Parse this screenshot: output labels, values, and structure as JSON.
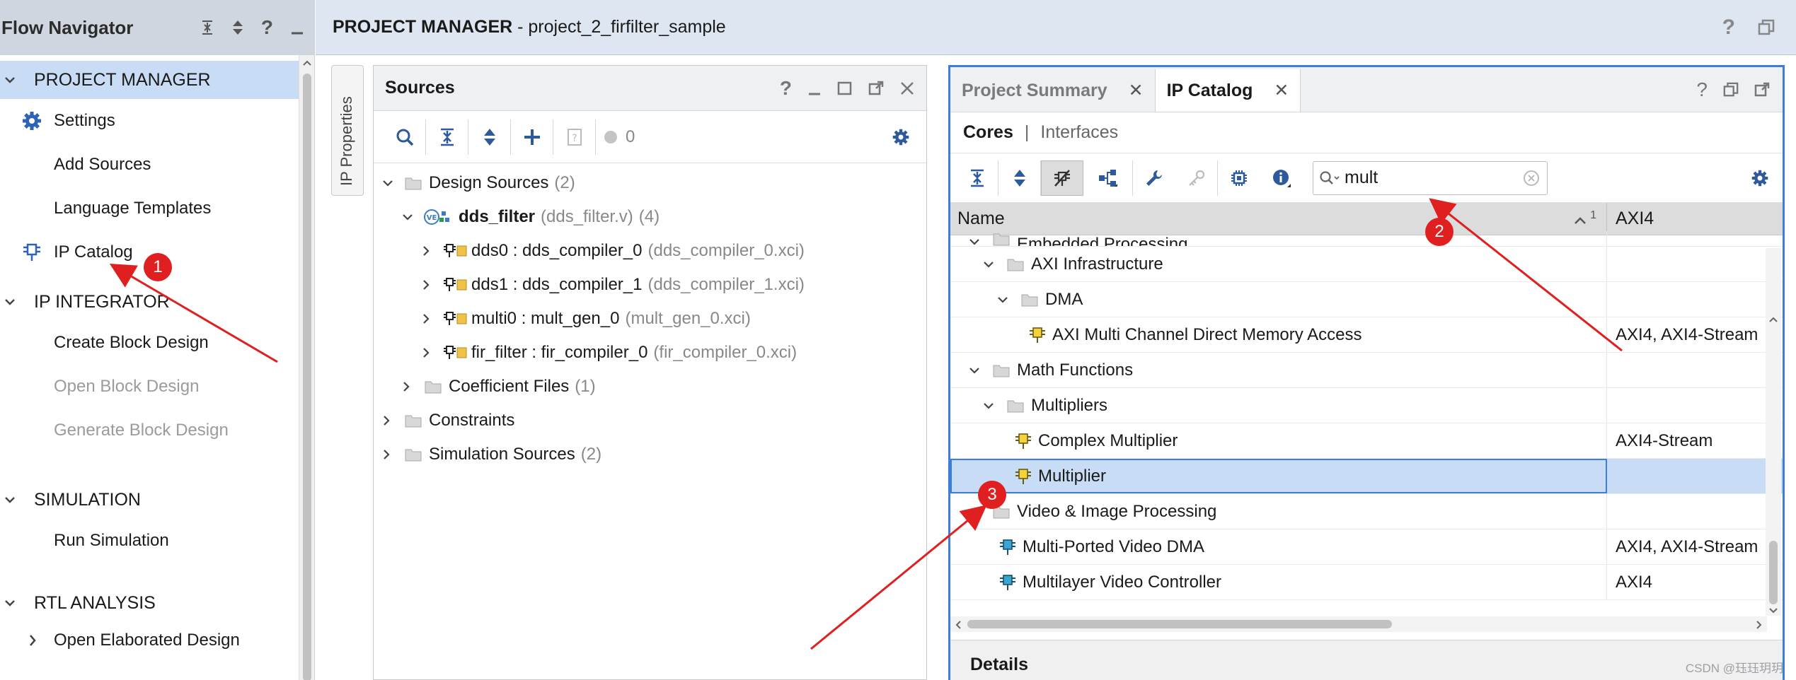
{
  "flow_navigator": {
    "title": "Flow Navigator",
    "sections": [
      {
        "label": "PROJECT MANAGER",
        "items": [
          "Settings",
          "Add Sources",
          "Language Templates",
          "IP Catalog"
        ]
      },
      {
        "label": "IP INTEGRATOR",
        "items": [
          "Create Block Design",
          "Open Block Design",
          "Generate Block Design"
        ]
      },
      {
        "label": "SIMULATION",
        "items": [
          "Run Simulation"
        ]
      },
      {
        "label": "RTL ANALYSIS",
        "items": [
          "Open Elaborated Design"
        ]
      }
    ]
  },
  "header": {
    "title_bold": "PROJECT MANAGER",
    "title_rest": " - project_2_firfilter_sample",
    "help": "?"
  },
  "ip_properties": {
    "label": "IP Properties"
  },
  "sources": {
    "title": "Sources",
    "error_count": "0",
    "tree": {
      "design_sources": {
        "label": "Design Sources",
        "count": "(2)"
      },
      "top": {
        "name": "dds_filter",
        "file": "(dds_filter.v)",
        "count": "(4)"
      },
      "children": [
        {
          "inst": "dds0 : dds_compiler_0",
          "file": "(dds_compiler_0.xci)"
        },
        {
          "inst": "dds1 : dds_compiler_1",
          "file": "(dds_compiler_1.xci)"
        },
        {
          "inst": "multi0 : mult_gen_0",
          "file": "(mult_gen_0.xci)"
        },
        {
          "inst": "fir_filter : fir_compiler_0",
          "file": "(fir_compiler_0.xci)"
        }
      ],
      "coeff": {
        "label": "Coefficient Files",
        "count": "(1)"
      },
      "constraints": {
        "label": "Constraints"
      },
      "sim": {
        "label": "Simulation Sources",
        "count": "(2)"
      }
    }
  },
  "catalog": {
    "tabs": [
      {
        "label": "Project Summary"
      },
      {
        "label": "IP Catalog"
      }
    ],
    "subtabs": {
      "cores": "Cores",
      "divider": "|",
      "interfaces": "Interfaces"
    },
    "search_value": "mult",
    "columns": {
      "name": "Name",
      "sort_index": "1",
      "interface": "AXI4"
    },
    "rows": [
      {
        "name": "Embedded Processing",
        "iface": "",
        "level": 1,
        "kind": "folder"
      },
      {
        "name": "AXI Infrastructure",
        "iface": "",
        "level": 2,
        "kind": "folder"
      },
      {
        "name": "DMA",
        "iface": "",
        "level": 3,
        "kind": "folder"
      },
      {
        "name": "AXI Multi Channel Direct Memory Access",
        "iface": "AXI4, AXI4-Stream",
        "level": 4,
        "kind": "ip"
      },
      {
        "name": "Math Functions",
        "iface": "",
        "level": 1,
        "kind": "folder"
      },
      {
        "name": "Multipliers",
        "iface": "",
        "level": 2,
        "kind": "folder"
      },
      {
        "name": "Complex Multiplier",
        "iface": "AXI4-Stream",
        "level": 3,
        "kind": "ip"
      },
      {
        "name": "Multiplier",
        "iface": "",
        "level": 3,
        "kind": "ip"
      },
      {
        "name": "Video & Image Processing",
        "iface": "",
        "level": 1,
        "kind": "folder"
      },
      {
        "name": "Multi-Ported Video DMA",
        "iface": "AXI4, AXI4-Stream",
        "level": 2,
        "kind": "ip-blue"
      },
      {
        "name": "Multilayer Video Controller",
        "iface": "AXI4",
        "level": 2,
        "kind": "ip-blue"
      }
    ],
    "details": "Details"
  },
  "annotations": [
    "1",
    "2",
    "3"
  ],
  "watermark": "CSDN @珏珏玥玥",
  "colors": {
    "accent": "#3d7fd6",
    "selection": "#c8dcf5",
    "badge": "#e02020",
    "nav_header": "#cfd6e0"
  }
}
